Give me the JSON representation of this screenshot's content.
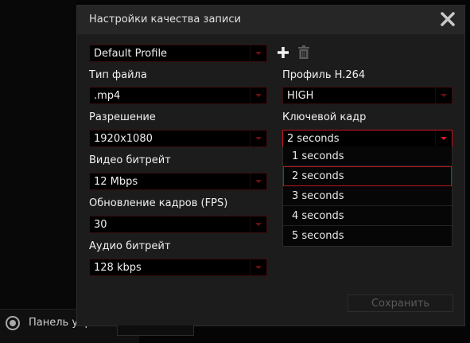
{
  "background": {
    "panel_label": "Панель упр"
  },
  "dialog": {
    "title": "Настройки качества записи",
    "profile": {
      "value": "Default Profile"
    },
    "file_type": {
      "label": "Тип файла",
      "value": ".mp4"
    },
    "resolution": {
      "label": "Разрешение",
      "value": "1920x1080"
    },
    "video_bitrate": {
      "label": "Видео битрейт",
      "value": "12 Mbps"
    },
    "fps": {
      "label": "Обновление кадров (FPS)",
      "value": "30"
    },
    "audio_bitrate": {
      "label": "Аудио битрейт",
      "value": "128 kbps"
    },
    "h264_profile": {
      "label": "Профиль H.264",
      "value": "HIGH"
    },
    "keyframe": {
      "label": "Ключевой кадр",
      "value": "2 seconds",
      "options": [
        "1 seconds",
        "2 seconds",
        "3 seconds",
        "4 seconds",
        "5 seconds"
      ],
      "selected_index": 1
    },
    "save_label": "Сохранить"
  },
  "colors": {
    "accent": "#c8151c",
    "dialog_bg": "#1c1c1c",
    "header_bg": "#262626",
    "field_bg": "#000000"
  },
  "icons": [
    "close-icon",
    "plus-icon",
    "trash-icon",
    "chevron-down-icon"
  ]
}
